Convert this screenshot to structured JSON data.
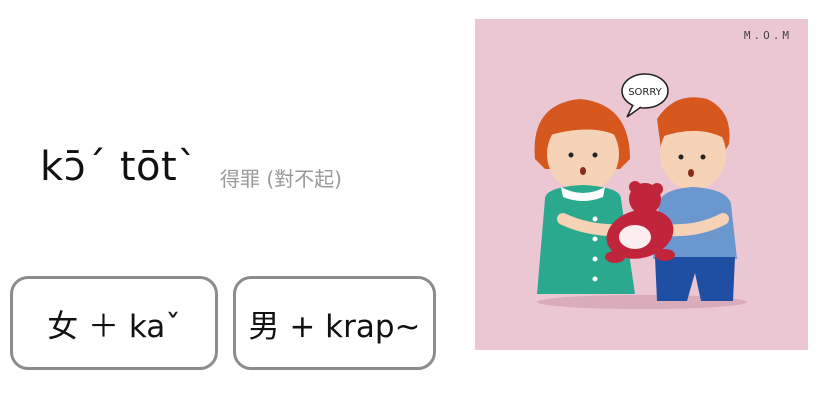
{
  "word": {
    "romanization": "kɔ̄ˊ tōtˋ",
    "meaning": "得罪 (對不起)"
  },
  "boxes": [
    {
      "text": "女 ＋ kaˇ"
    },
    {
      "text": "男 + krap~"
    }
  ],
  "illustration": {
    "brand": "M.O.M",
    "speech": "SORRY",
    "colors": {
      "background": "#ebc6d3",
      "hair": "#d6581f",
      "girl_dress": "#2aa98f",
      "boy_shirt": "#6b97cf",
      "boy_pants": "#1f4fa3",
      "teddy": "#c0253b"
    }
  }
}
